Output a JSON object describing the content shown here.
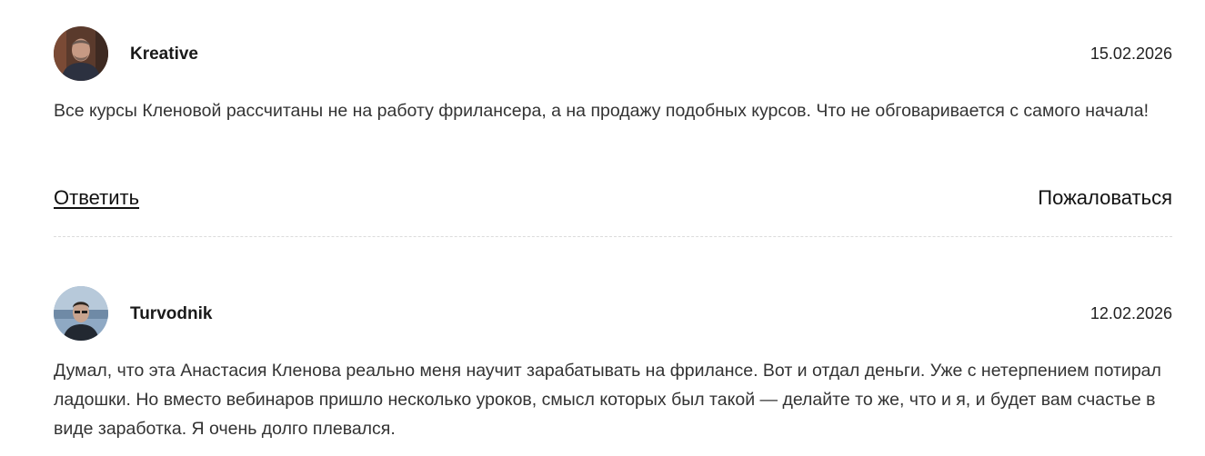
{
  "comments": [
    {
      "author": "Kreative",
      "date": "15.02.2026",
      "text": "Все курсы Кленовой рассчитаны не на работу фрилансера, а на продажу подобных курсов. Что не обговаривается с самого начала!",
      "reply_label": "Ответить",
      "report_label": "Пожаловаться",
      "avatar_icon": "user-photo-icon"
    },
    {
      "author": "Turvodnik",
      "date": "12.02.2026",
      "text": "Думал, что эта Анастасия Кленова реально меня научит зарабатывать на фрилансе. Вот и отдал деньги. Уже с нетерпением потирал ладошки. Но вместо вебинаров пришло несколько уроков, смысл которых был такой — делайте то же, что и я, и будет вам счастье в виде заработка. Я очень долго плевался.",
      "avatar_icon": "user-photo-icon"
    }
  ]
}
